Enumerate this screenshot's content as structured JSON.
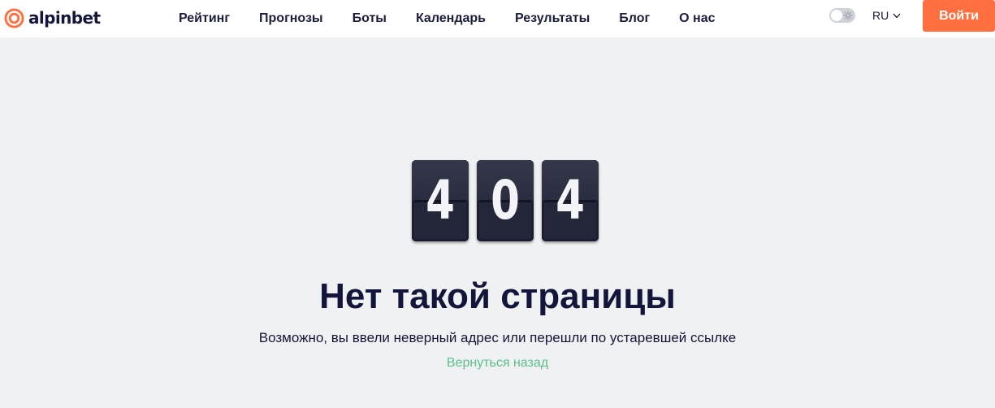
{
  "brand": {
    "name": "alpinbet",
    "accent_color": "#ff6f3f"
  },
  "nav": {
    "items": [
      {
        "label": "Рейтинг"
      },
      {
        "label": "Прогнозы"
      },
      {
        "label": "Боты"
      },
      {
        "label": "Календарь"
      },
      {
        "label": "Результаты"
      },
      {
        "label": "Блог"
      },
      {
        "label": "О нас"
      }
    ]
  },
  "header": {
    "theme_toggle": {
      "state": "light",
      "icon": "sun-icon"
    },
    "language": {
      "selected": "RU",
      "icon": "chevron-down-icon"
    },
    "login_label": "Войти"
  },
  "error": {
    "digits": [
      "4",
      "0",
      "4"
    ],
    "title": "Нет такой страницы",
    "description": "Возможно, вы ввели неверный адрес или перешли по устаревшей ссылке",
    "back_link": "Вернуться назад",
    "link_color": "#5cbf8f"
  }
}
